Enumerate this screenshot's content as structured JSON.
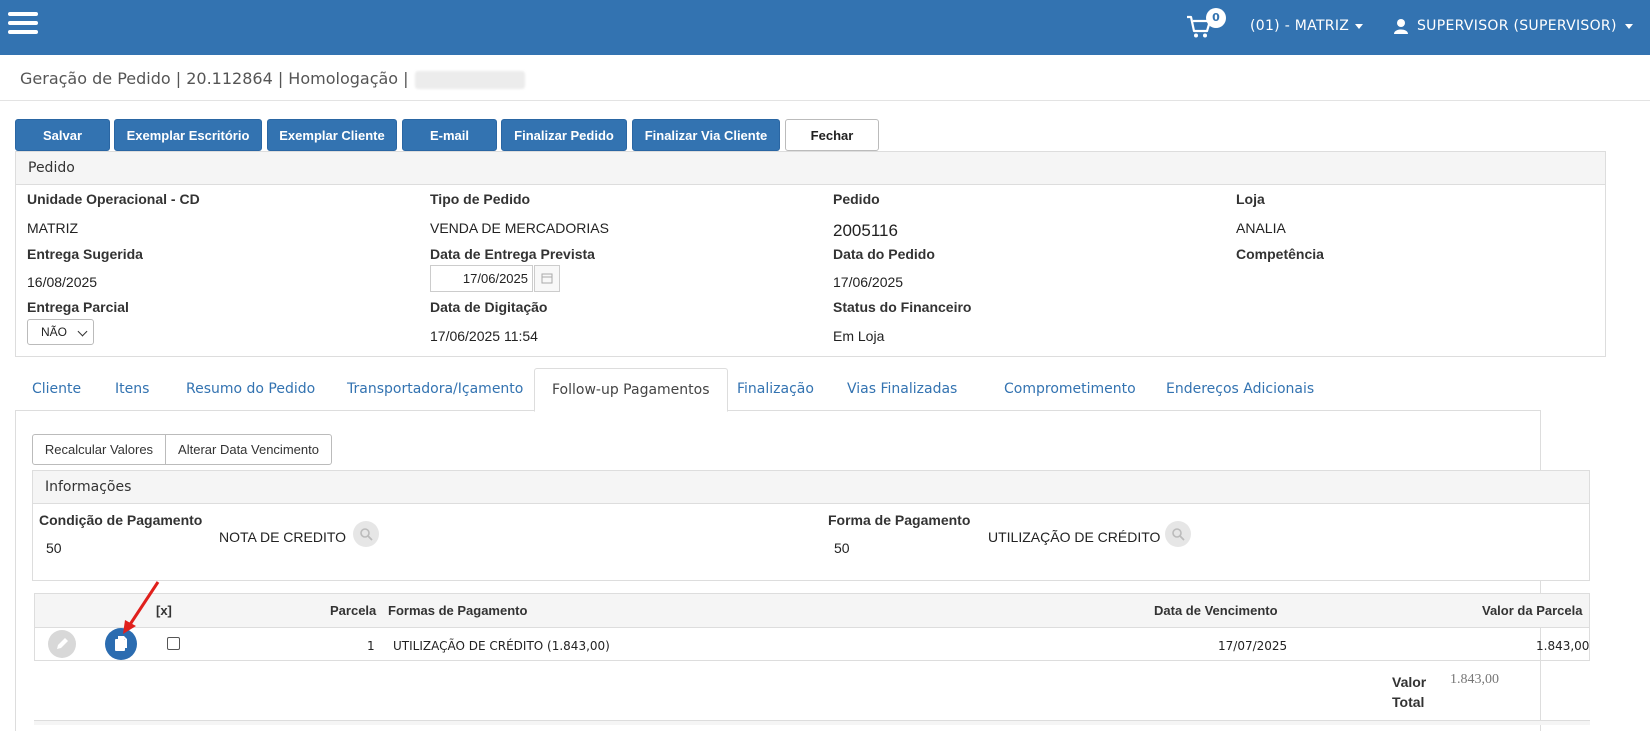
{
  "topbar": {
    "cart_count": "0",
    "branch": "(01) - MATRIZ",
    "user": "SUPERVISOR (SUPERVISOR)"
  },
  "page": {
    "title": "Geração de Pedido | 20.112864 | Homologação |"
  },
  "actions": {
    "salvar": "Salvar",
    "exemplar_escritorio": "Exemplar Escritório",
    "exemplar_cliente": "Exemplar Cliente",
    "email": "E-mail",
    "finalizar_pedido": "Finalizar Pedido",
    "finalizar_via_cliente": "Finalizar Via Cliente",
    "fechar": "Fechar"
  },
  "pedido": {
    "heading": "Pedido",
    "unidade_label": "Unidade Operacional - CD",
    "unidade_value": "MATRIZ",
    "tipo_label": "Tipo de Pedido",
    "tipo_value": "VENDA DE MERCADORIAS",
    "pedido_label": "Pedido",
    "pedido_value": "2005116",
    "loja_label": "Loja",
    "loja_value": "ANALIA",
    "entrega_sugerida_label": "Entrega Sugerida",
    "entrega_sugerida_value": "16/08/2025",
    "entrega_prevista_label": "Data de Entrega Prevista",
    "entrega_prevista_value": "17/06/2025",
    "data_pedido_label": "Data do Pedido",
    "data_pedido_value": "17/06/2025",
    "competencia_label": "Competência",
    "entrega_parcial_label": "Entrega Parcial",
    "entrega_parcial_value": "NÃO",
    "digitacao_label": "Data de Digitação",
    "digitacao_value": "17/06/2025 11:54",
    "status_fin_label": "Status do Financeiro",
    "status_fin_value": "Em Loja"
  },
  "tabs": [
    {
      "label": "Cliente"
    },
    {
      "label": "Itens"
    },
    {
      "label": "Resumo do Pedido"
    },
    {
      "label": "Transportadora/Içamento"
    },
    {
      "label": "Follow-up Pagamentos"
    },
    {
      "label": "Finalização"
    },
    {
      "label": "Vias Finalizadas"
    },
    {
      "label": "Comprometimento"
    },
    {
      "label": "Endereços Adicionais"
    }
  ],
  "followup": {
    "recalcular": "Recalcular Valores",
    "alterar_data": "Alterar Data Vencimento",
    "info_heading": "Informações",
    "condicao_label": "Condição de Pagamento",
    "condicao_code": "50",
    "condicao_desc": "NOTA DE CREDITO",
    "forma_label": "Forma de Pagamento",
    "forma_code": "50",
    "forma_desc": "UTILIZAÇÃO DE CRÉDITO"
  },
  "grid": {
    "headers": {
      "select": "[x]",
      "parcela": "Parcela",
      "formas": "Formas de Pagamento",
      "vencimento": "Data de Vencimento",
      "valor": "Valor da Parcela"
    },
    "rows": [
      {
        "parcela": "1",
        "forma": "UTILIZAÇÃO DE CRÉDITO (1.843,00)",
        "vencimento": "17/07/2025",
        "valor": "1.843,00"
      }
    ]
  },
  "total": {
    "label": "Valor Total",
    "value": "1.843,00"
  },
  "colors": {
    "brand": "#3373b1",
    "annotation_arrow": "#e0201c"
  }
}
